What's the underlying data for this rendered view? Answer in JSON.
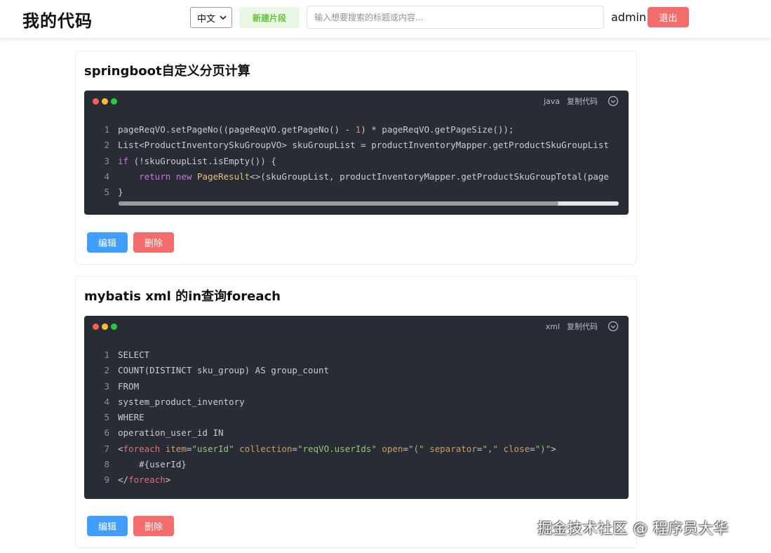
{
  "header": {
    "app_title": "我的代码",
    "language_select": "中文",
    "new_snippet_label": "新建片段",
    "search_placeholder": "输入想要搜索的标题或内容...",
    "username": "admin",
    "logout_label": "退出"
  },
  "snippets": [
    {
      "title": "springboot自定义分页计算",
      "language": "java",
      "copy_label": "复制代码",
      "line_numbers": [
        "1",
        "2",
        "3",
        "4",
        "5"
      ],
      "lines": [
        "pageReqVO.setPageNo((pageReqVO.getPageNo() - 1) * pageReqVO.getPageSize());",
        "List<ProductInventorySkuGroupVO> skuGroupList = productInventoryMapper.getProductSkuGroupList",
        "if (!skuGroupList.isEmpty()) {",
        "    return new PageResult<>(skuGroupList, productInventoryMapper.getProductSkuGroupTotal(page",
        "}"
      ],
      "horizontal_scroll_fraction": 0.88,
      "edit_label": "编辑",
      "delete_label": "删除"
    },
    {
      "title": "mybatis xml 的in查询foreach",
      "language": "xml",
      "copy_label": "复制代码",
      "line_numbers": [
        "1",
        "2",
        "3",
        "4",
        "5",
        "6",
        "7",
        "8",
        "9"
      ],
      "lines": [
        "SELECT",
        "COUNT(DISTINCT sku_group) AS group_count",
        "FROM",
        "system_product_inventory",
        "WHERE",
        "operation_user_id IN",
        "<foreach item=\"userId\" collection=\"reqVO.userIds\" open=\"(\" separator=\",\" close=\")\">",
        "    #{userId}",
        "</foreach>"
      ],
      "edit_label": "编辑",
      "delete_label": "删除"
    }
  ],
  "watermark": "掘金技术社区 @ 程序员大华",
  "colors": {
    "code_bg": "#282c34",
    "primary": "#409eff",
    "danger": "#f56c6c",
    "success_text": "#67c23a"
  }
}
